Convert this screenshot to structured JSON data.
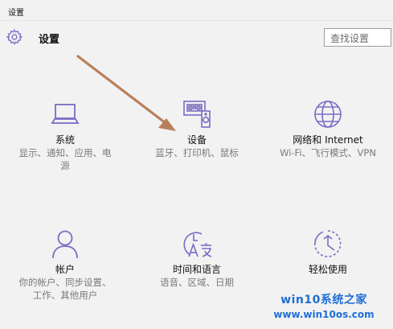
{
  "window": {
    "title": "设置"
  },
  "header": {
    "title": "设置",
    "icon": "gear-icon"
  },
  "search": {
    "placeholder": "查找设置"
  },
  "tiles": [
    {
      "label": "系统",
      "desc": [
        "显示、通知、应用、电",
        "源"
      ],
      "icon": "laptop-icon"
    },
    {
      "label": "设备",
      "desc": [
        "蓝牙、打印机、鼠标"
      ],
      "icon": "devices-icon"
    },
    {
      "label": "网络和 Internet",
      "desc": [
        "Wi-Fi、飞行模式、VPN"
      ],
      "icon": "globe-icon"
    },
    {
      "label": "帐户",
      "desc": [
        "你的帐户、同步设置、",
        "工作、其他用户"
      ],
      "icon": "person-icon"
    },
    {
      "label": "时间和语言",
      "desc": [
        "语音、区域、日期"
      ],
      "icon": "time-language-icon"
    },
    {
      "label": "轻松使用",
      "desc": [],
      "icon": "ease-of-access-icon"
    }
  ],
  "watermark": {
    "title": "win10系统之家",
    "url": "www.win10os.com"
  },
  "colors": {
    "accent": "#7a6cc4",
    "arrow": "#b8805a",
    "watermark": "#1f6fd6"
  }
}
